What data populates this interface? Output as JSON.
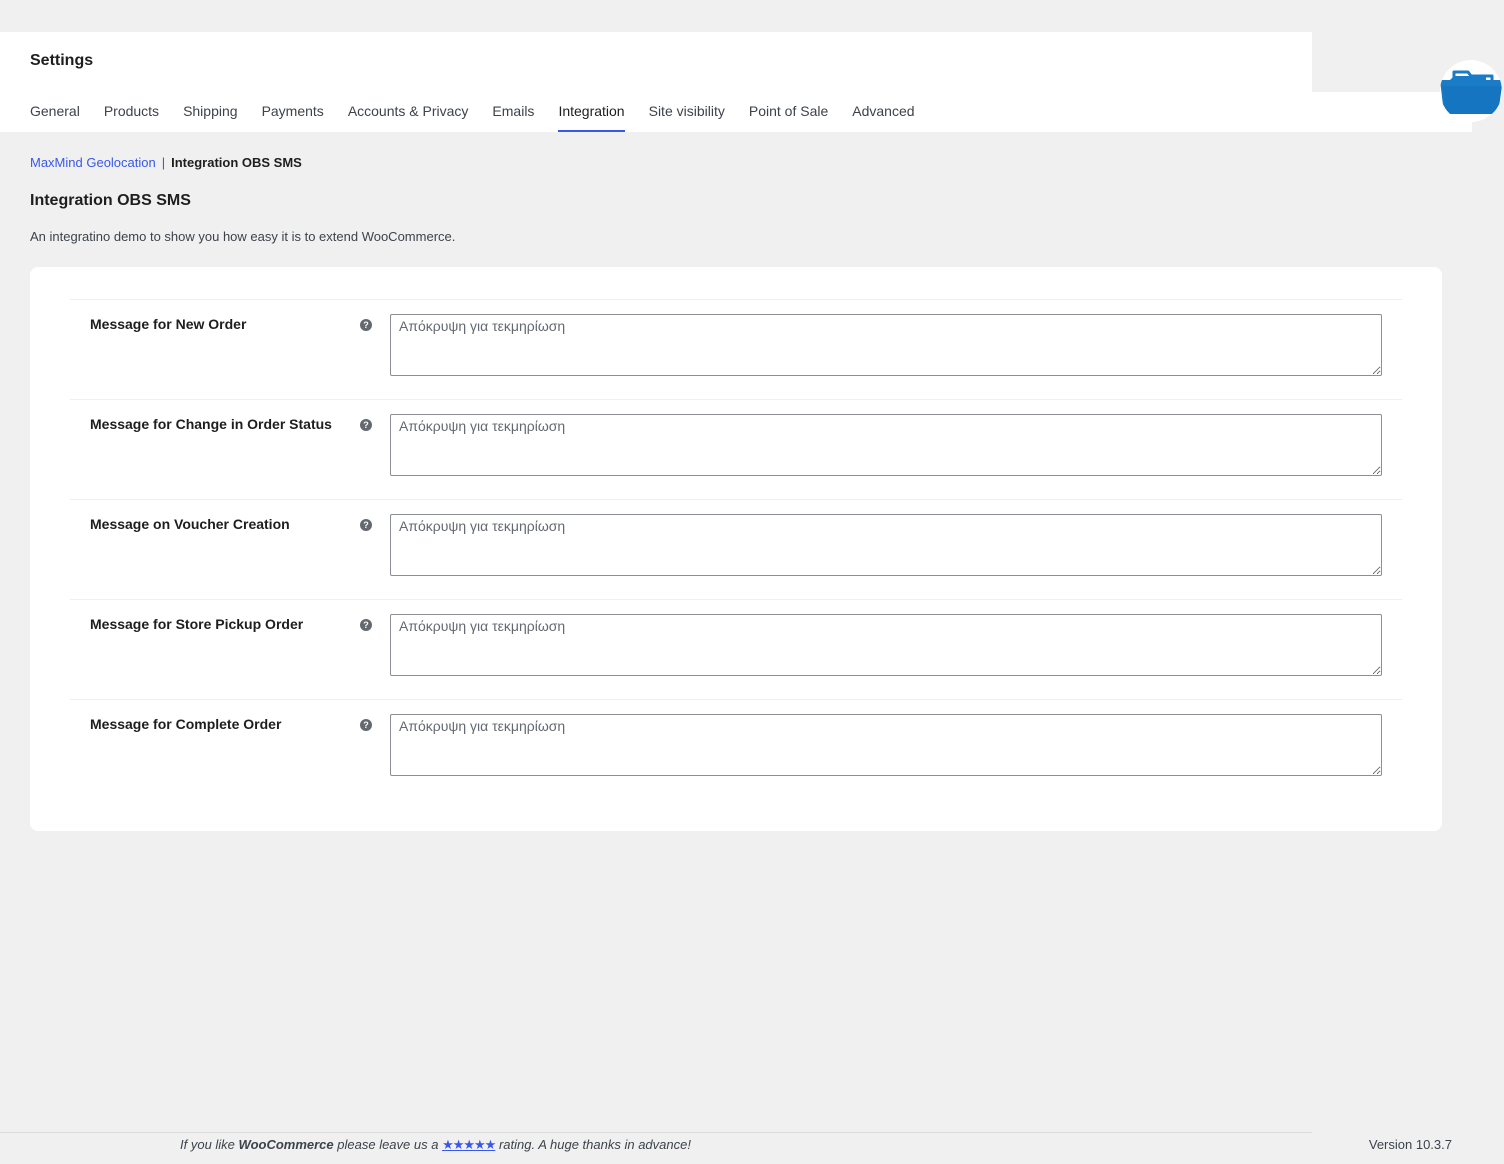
{
  "header": {
    "title": "Settings",
    "tabs": [
      {
        "label": "General",
        "active": false
      },
      {
        "label": "Products",
        "active": false
      },
      {
        "label": "Shipping",
        "active": false
      },
      {
        "label": "Payments",
        "active": false
      },
      {
        "label": "Accounts & Privacy",
        "active": false
      },
      {
        "label": "Emails",
        "active": false
      },
      {
        "label": "Integration",
        "active": true
      },
      {
        "label": "Site visibility",
        "active": false
      },
      {
        "label": "Point of Sale",
        "active": false
      },
      {
        "label": "Advanced",
        "active": false
      }
    ]
  },
  "breadcrumb": {
    "link": "MaxMind Geolocation",
    "separator": "|",
    "current": "Integration OBS SMS"
  },
  "section": {
    "title": "Integration OBS SMS",
    "description": "An integratino demo to show you how easy it is to extend WooCommerce."
  },
  "fields": [
    {
      "label": "Message for New Order",
      "value": "",
      "placeholder": "Απόκρυψη για τεκμηρίωση"
    },
    {
      "label": "Message for Change in Order Status",
      "value": "",
      "placeholder": "Απόκρυψη για τεκμηρίωση"
    },
    {
      "label": "Message on Voucher Creation",
      "value": "",
      "placeholder": "Απόκρυψη για τεκμηρίωση"
    },
    {
      "label": "Message for Store Pickup Order",
      "value": "",
      "placeholder": "Απόκρυψη για τεκμηρίωση"
    },
    {
      "label": "Message for Complete Order",
      "value": "",
      "placeholder": "Απόκρυψη για τεκμηρίωση"
    }
  ],
  "help_icon_glyph": "?",
  "footer": {
    "text_before": "If you like ",
    "brand": "WooCommerce",
    "text_middle": " please leave us a ",
    "stars": "★★★★★",
    "text_after": " rating. A huge thanks in advance!",
    "version": "Version 10.3.7"
  },
  "colors": {
    "accent": "#3858e9",
    "background": "#f0f0f1",
    "folder_icon": "#1a7bc6"
  },
  "icons": {
    "help": "help-circle-icon",
    "folder": "folder-open-icon"
  }
}
